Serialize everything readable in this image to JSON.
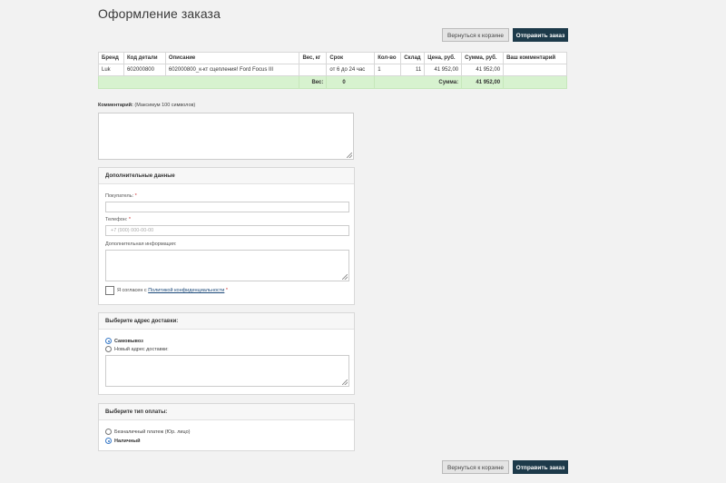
{
  "page": {
    "title": "Оформление заказа"
  },
  "buttons": {
    "back": "Вернуться к корзине",
    "submit": "Отправить заказ"
  },
  "table": {
    "headers": [
      "Бренд",
      "Код детали",
      "Описание",
      "Вес, кг",
      "Срок",
      "Кол-во",
      "Склад",
      "Цена, руб.",
      "Сумма, руб.",
      "Ваш комментарий"
    ],
    "row": {
      "brand": "Luk",
      "code": "602000800",
      "description": "602000800_к-кт сцепления! Ford Focus III",
      "weight": "",
      "term": "от 6 до 24 час",
      "qty": "1",
      "stock": "11",
      "price": "41 952,00",
      "sum": "41 952,00",
      "comment": ""
    },
    "totals": {
      "weight_label": "Вес:",
      "weight_value": "0",
      "sum_label": "Сумма:",
      "sum_value": "41 952,00"
    }
  },
  "comment": {
    "label": "Комментарий:",
    "hint": "(Максимум 100 символов)"
  },
  "extra": {
    "title": "Дополнительные данные",
    "buyer_label": "Покупатель:",
    "phone_label": "Телефон:",
    "phone_placeholder": "+7 (900) 000-00-00",
    "info_label": "Дополнительная информация:",
    "agree_prefix": "Я согласен с",
    "agree_link": "Политикой конфиденциальности",
    "required_mark": "*"
  },
  "delivery": {
    "title": "Выберите адрес доставки:",
    "option_pickup": "Самовывоз",
    "option_new": "Новый адрес доставки:"
  },
  "payment": {
    "title": "Выберите тип оплаты:",
    "option_cashless": "Безналичный платеж (Юр. лицо)",
    "option_cash": "Наличный"
  },
  "colors": {
    "accent": "#1d3a4a",
    "totals_bg": "#d7f2cf",
    "radio_on": "#3a7bc8"
  }
}
